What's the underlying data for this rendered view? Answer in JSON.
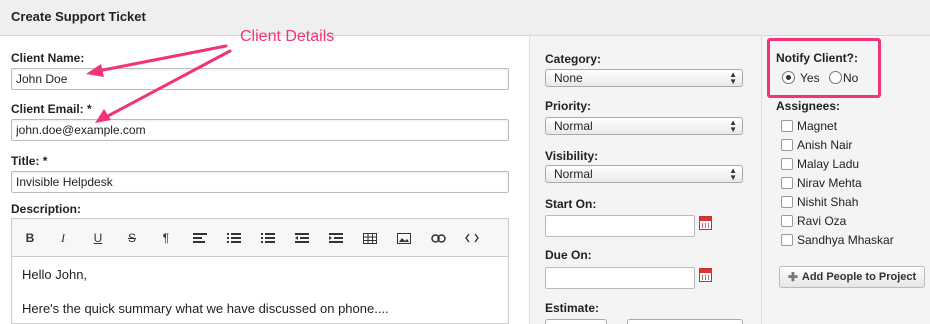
{
  "header": {
    "title": "Create Support Ticket"
  },
  "annotation": {
    "text": "Client Details",
    "color": "#f0337a"
  },
  "form": {
    "client_name": {
      "label": "Client Name:",
      "value": "John Doe"
    },
    "client_email": {
      "label": "Client Email: *",
      "value": "john.doe@example.com"
    },
    "title": {
      "label": "Title: *",
      "value": "Invisible Helpdesk"
    },
    "description": {
      "label": "Description:",
      "lines": [
        "Hello John,",
        "Here's the quick summary what we have discussed on phone...."
      ]
    },
    "toolbar": [
      "bold-icon",
      "italic-icon",
      "underline-icon",
      "strikethrough-icon",
      "paragraph-icon",
      "align-left-icon",
      "bullet-list-icon",
      "numbered-list-icon",
      "outdent-icon",
      "indent-icon",
      "table-icon",
      "image-icon",
      "link-icon",
      "code-icon"
    ]
  },
  "side": {
    "category": {
      "label": "Category:",
      "value": "None"
    },
    "priority": {
      "label": "Priority:",
      "value": "Normal"
    },
    "visibility": {
      "label": "Visibility:",
      "value": "Normal"
    },
    "start_on": {
      "label": "Start On:",
      "value": ""
    },
    "due_on": {
      "label": "Due On:",
      "value": ""
    },
    "estimate": {
      "label": "Estimate:"
    }
  },
  "notify": {
    "label": "Notify Client?:",
    "yes": "Yes",
    "no": "No",
    "selected": "Yes"
  },
  "assignees": {
    "label": "Assignees:",
    "people": [
      "Magnet",
      "Anish Nair",
      "Malay Ladu",
      "Nirav Mehta",
      "Nishit Shah",
      "Ravi Oza",
      "Sandhya Mhaskar"
    ]
  },
  "add_people_button": "Add People to Project"
}
